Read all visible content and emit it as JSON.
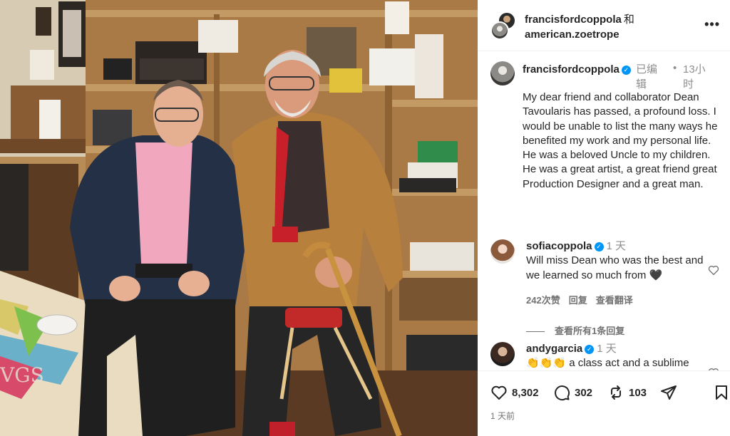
{
  "header": {
    "user1": "francisfordcoppola",
    "conjunction": "和",
    "user2": "american.zoetrope",
    "more_icon": "more-icon"
  },
  "caption": {
    "username": "francisfordcoppola",
    "verified": true,
    "edited": "已编辑",
    "dot": "•",
    "time": "13小时",
    "text": "My dear friend and collaborator Dean Tavoularis has passed, a profound loss. I would be unable to list the many ways he benefited my work and my personal life. He was a beloved Uncle to my children. He was a great artist, a great friend great Production Designer and a great man."
  },
  "comments": [
    {
      "username": "sofiacoppola",
      "time": "1 天",
      "text": "Will miss Dean who was the best and we learned so much from 🖤",
      "likes": "242次赞",
      "reply": "回复",
      "translate": "查看翻译",
      "view_replies": "查看所有1条回复"
    },
    {
      "username": "andygarcia",
      "time": "1 天",
      "text": "👏👏👏 a class act and a sublime"
    }
  ],
  "actions": {
    "likes": "8,302",
    "comments": "302",
    "reposts": "103",
    "post_time": "1 天前"
  },
  "colors": {
    "verified": "#0095f6",
    "meta_grey": "#8e8e8e",
    "text": "#262626"
  }
}
